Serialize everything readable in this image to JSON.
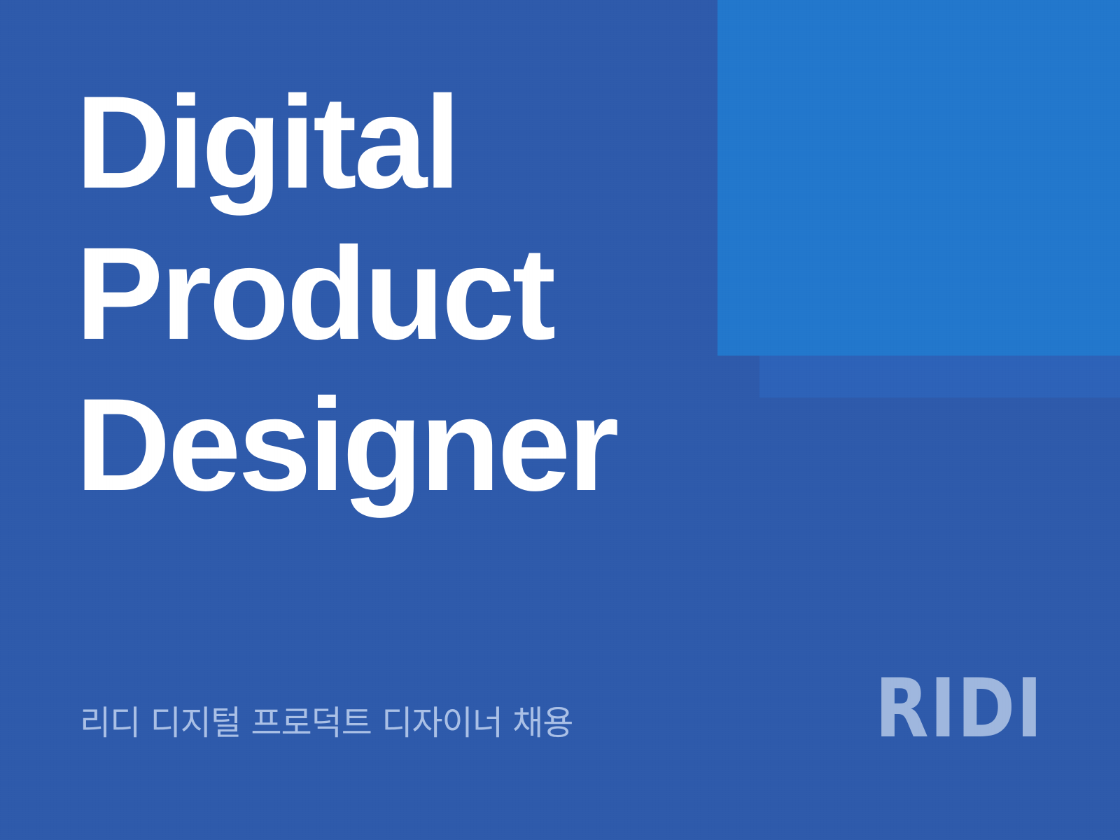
{
  "colors": {
    "background": "#2e5aab",
    "accent_block": "#2277cc",
    "accent_block_shadow": "#2d62b8",
    "title_text": "#ffffff",
    "subtitle_text": "#aac0e6",
    "logo_text": "#9fb7de"
  },
  "poster": {
    "title_lines": [
      "Digital",
      "Product",
      "Designer"
    ],
    "subtitle": "리디 디지털 프로덕트 디자이너 채용",
    "logo": "RIDI"
  }
}
